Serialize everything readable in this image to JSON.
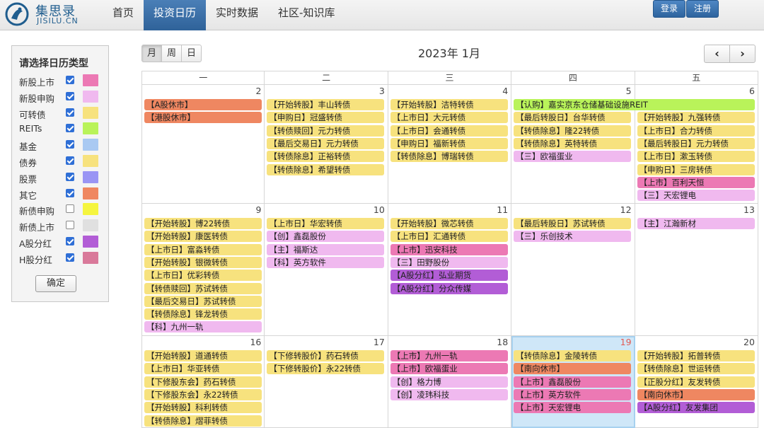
{
  "colors": {
    "cb": "#f7e27e",
    "ipo": "#f0b9ef",
    "stock": "#f7e27e",
    "other": "#ef8761",
    "reits": "#b9f35a",
    "listing": "#ec79b4",
    "dividend": "#b25dd6",
    "fund": "#a9c9f2",
    "bond": "#f7e27e",
    "stock_swatch": "#9a95f4",
    "newbond_apply": "#f5f53f",
    "newbond_list": "#e0e0e0",
    "h_dividend": "#d9799a"
  },
  "header": {
    "logo_cn": "集思录",
    "logo_en": "JISILU.CN",
    "nav": [
      "首页",
      "投资日历",
      "实时数据",
      "社区-知识库"
    ],
    "login": "登录",
    "register": "注册"
  },
  "sidebar": {
    "title": "请选择日历类型",
    "types": [
      {
        "label": "新股上市",
        "checked": true,
        "color": "#ec79b4"
      },
      {
        "label": "新股申购",
        "checked": true,
        "color": "#f0b9ef"
      },
      {
        "label": "可转债",
        "checked": true,
        "color": "#f7e27e"
      },
      {
        "label": "REITs",
        "checked": true,
        "color": "#b9f35a"
      },
      {
        "label": "基金",
        "checked": true,
        "color": "#a9c9f2"
      },
      {
        "label": "债券",
        "checked": true,
        "color": "#f7e27e"
      },
      {
        "label": "股票",
        "checked": true,
        "color": "#9a95f4"
      },
      {
        "label": "其它",
        "checked": true,
        "color": "#ef8761"
      },
      {
        "label": "新债申购",
        "checked": false,
        "color": "#f5f53f"
      },
      {
        "label": "新债上市",
        "checked": false,
        "color": "#e0e0e0"
      },
      {
        "label": "A股分红",
        "checked": true,
        "color": "#b25dd6"
      },
      {
        "label": "H股分红",
        "checked": true,
        "color": "#d9799a"
      }
    ],
    "confirm": "确定"
  },
  "calendar": {
    "views": [
      "月",
      "周",
      "日"
    ],
    "title": "2023年 1月",
    "prev": "‹",
    "next": "›",
    "weekdays": [
      "一",
      "二",
      "三",
      "四",
      "五"
    ],
    "weeks": [
      {
        "days": [
          {
            "num": "2",
            "events": [
              [
                "【A股休市】",
                "other"
              ],
              [
                "【港股休市】",
                "other"
              ]
            ]
          },
          {
            "num": "3",
            "events": [
              [
                "【开始转股】丰山转债",
                "cb"
              ],
              [
                "【申购日】冠盛转债",
                "cb"
              ],
              [
                "【转债赎回】元力转债",
                "cb"
              ],
              [
                "【最后交易日】元力转债",
                "cb"
              ],
              [
                "【转债除息】正裕转债",
                "cb"
              ],
              [
                "【转债除息】希望转债",
                "cb"
              ]
            ]
          },
          {
            "num": "4",
            "events": [
              [
                "【开始转股】洁特转债",
                "cb"
              ],
              [
                "【上市日】大元转债",
                "cb"
              ],
              [
                "【上市日】会通转债",
                "cb"
              ],
              [
                "【申购日】福新转债",
                "cb"
              ],
              [
                "【转债除息】博瑞转债",
                "cb"
              ]
            ]
          },
          {
            "num": "5",
            "events": [
              null,
              [
                "【最后转股日】台华转债",
                "cb"
              ],
              [
                "【转债除息】隆22转债",
                "cb"
              ],
              [
                "【转债除息】英特转债",
                "cb"
              ],
              [
                "【三】欧福蛋业",
                "ipo"
              ]
            ]
          },
          {
            "num": "6",
            "events": [
              null,
              [
                "【开始转股】九强转债",
                "cb"
              ],
              [
                "【上市日】合力转债",
                "cb"
              ],
              [
                "【最后转股日】元力转债",
                "cb"
              ],
              [
                "【上市日】漱玉转债",
                "cb"
              ],
              [
                "【申购日】三房转债",
                "cb"
              ],
              [
                "【上市】百利天恒",
                "listing"
              ],
              [
                "【三】天宏锂电",
                "ipo"
              ]
            ]
          }
        ],
        "span_event": "【认购】嘉实京东仓储基础设施REIT"
      },
      {
        "days": [
          {
            "num": "9",
            "events": [
              [
                "【开始转股】博22转债",
                "cb"
              ],
              [
                "【开始转股】康医转债",
                "cb"
              ],
              [
                "【上市日】富淼转债",
                "cb"
              ],
              [
                "【开始转股】银微转债",
                "cb"
              ],
              [
                "【上市日】优彩转债",
                "cb"
              ],
              [
                "【转债赎回】苏试转债",
                "cb"
              ],
              [
                "【最后交易日】苏试转债",
                "cb"
              ],
              [
                "【转债除息】锋龙转债",
                "cb"
              ],
              [
                "【科】九州一轨",
                "ipo"
              ]
            ]
          },
          {
            "num": "10",
            "events": [
              [
                "【上市日】华宏转债",
                "cb"
              ],
              [
                "【创】鑫磊股份",
                "ipo"
              ],
              [
                "【主】福斯达",
                "ipo"
              ],
              [
                "【科】英方软件",
                "ipo"
              ]
            ]
          },
          {
            "num": "11",
            "events": [
              [
                "【开始转股】微芯转债",
                "cb"
              ],
              [
                "【上市日】汇通转债",
                "cb"
              ],
              [
                "【上市】迅安科技",
                "listing"
              ],
              [
                "【三】田野股份",
                "ipo"
              ],
              [
                "【A股分红】弘业期货",
                "dividend"
              ],
              [
                "【A股分红】分众传媒",
                "dividend"
              ]
            ]
          },
          {
            "num": "12",
            "events": [
              [
                "【最后转股日】苏试转债",
                "cb"
              ],
              [
                "【三】乐创技术",
                "ipo"
              ]
            ]
          },
          {
            "num": "13",
            "events": [
              [
                "【主】江瀚新材",
                "ipo"
              ]
            ]
          }
        ]
      },
      {
        "days": [
          {
            "num": "16",
            "events": [
              [
                "【开始转股】道通转债",
                "cb"
              ],
              [
                "【上市日】华亚转债",
                "cb"
              ],
              [
                "【下修股东会】药石转债",
                "cb"
              ],
              [
                "【下修股东会】永22转债",
                "cb"
              ],
              [
                "【开始转股】科利转债",
                "cb"
              ],
              [
                "【转债除息】熠菲转债",
                "cb"
              ]
            ]
          },
          {
            "num": "17",
            "events": [
              [
                "【下修转股价】药石转债",
                "cb"
              ],
              [
                "【下修转股价】永22转债",
                "cb"
              ]
            ]
          },
          {
            "num": "18",
            "events": [
              [
                "【上市】九州一轨",
                "listing"
              ],
              [
                "【上市】欧福蛋业",
                "listing"
              ],
              [
                "【创】格力博",
                "ipo"
              ],
              [
                "【创】凌玮科技",
                "ipo"
              ]
            ]
          },
          {
            "num": "19",
            "today": true,
            "events": [
              [
                "【转债除息】金陵转债",
                "cb"
              ],
              [
                "【南向休市】",
                "other"
              ],
              [
                "【上市】鑫磊股份",
                "listing"
              ],
              [
                "【上市】英方软件",
                "listing"
              ],
              [
                "【上市】天宏锂电",
                "listing"
              ]
            ]
          },
          {
            "num": "20",
            "events": [
              [
                "【开始转股】拓普转债",
                "cb"
              ],
              [
                "【转债除息】世运转债",
                "cb"
              ],
              [
                "【正股分红】友发转债",
                "cb"
              ],
              [
                "【南向休市】",
                "other"
              ],
              [
                "【A股分红】友发集团",
                "dividend"
              ]
            ]
          }
        ]
      }
    ]
  }
}
